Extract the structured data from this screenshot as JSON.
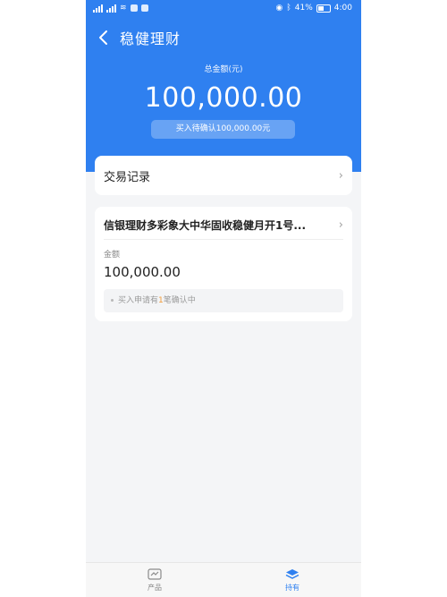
{
  "status_bar": {
    "time": "4:00",
    "battery": "41%"
  },
  "header": {
    "title": "稳健理财"
  },
  "summary": {
    "total_label": "总金额(元)",
    "total_amount": "100,000.00",
    "pending_text": "买入待确认100,000.00元"
  },
  "records": {
    "label": "交易记录"
  },
  "product": {
    "name": "信银理财多彩象大中华固收稳健月开1号...",
    "amount_label": "金额",
    "amount_value": "100,000.00",
    "note_prefix": "买入申请有",
    "note_count": "1",
    "note_suffix": "笔确认中"
  },
  "tabs": [
    {
      "label": "产品",
      "icon": "product-icon"
    },
    {
      "label": "持有",
      "icon": "holdings-icon"
    }
  ],
  "colors": {
    "primary": "#2f80f0",
    "highlight": "#f29b38",
    "background": "#f4f5f7"
  }
}
